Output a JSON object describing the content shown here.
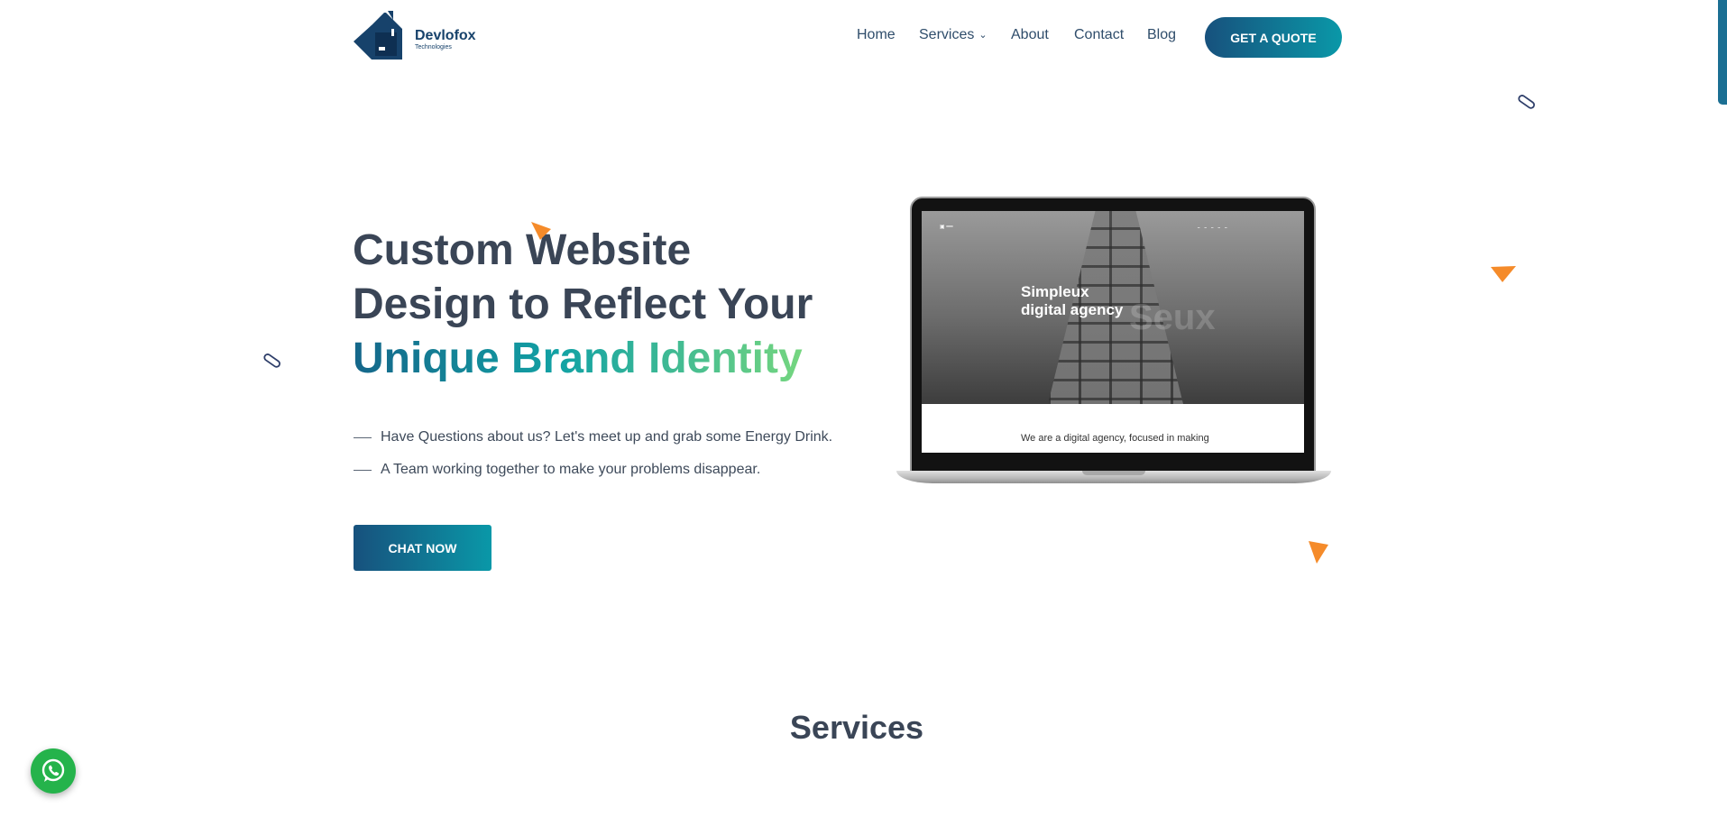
{
  "brand": {
    "name": "Devlofox",
    "tagline": "Technologies"
  },
  "nav": {
    "items": [
      {
        "label": "Home"
      },
      {
        "label": "Services"
      },
      {
        "label": "About"
      },
      {
        "label": "Contact"
      },
      {
        "label": "Blog"
      }
    ],
    "cta_label": "GET A QUOTE"
  },
  "hero": {
    "title_line1": "Custom Website",
    "title_line2": "Design to Reflect Your",
    "title_line3": "Unique Brand Identity",
    "bullets": [
      "Have Questions about us? Let's meet up and grab some Energy Drink.",
      "A Team working together to make your problems disappear."
    ],
    "button_label": "CHAT NOW"
  },
  "laptop_screen": {
    "title_line1": "Simpleux",
    "title_line2": "digital agency",
    "ghost_text": "Seux",
    "body_text": "We are a digital agency, focused in making"
  },
  "services": {
    "heading": "Services"
  },
  "colors": {
    "primary_dark": "#17517d",
    "primary_teal": "#0a98a8",
    "text_dark": "#3a4556",
    "accent_orange": "#f58b2a",
    "whatsapp_green": "#25b34b"
  },
  "icons": {
    "logo": "house-logo-icon",
    "services_dropdown": "chevron-down-icon",
    "whatsapp": "whatsapp-icon",
    "decorations": [
      "orange-triangle-icon",
      "capsule-outline-icon"
    ]
  }
}
